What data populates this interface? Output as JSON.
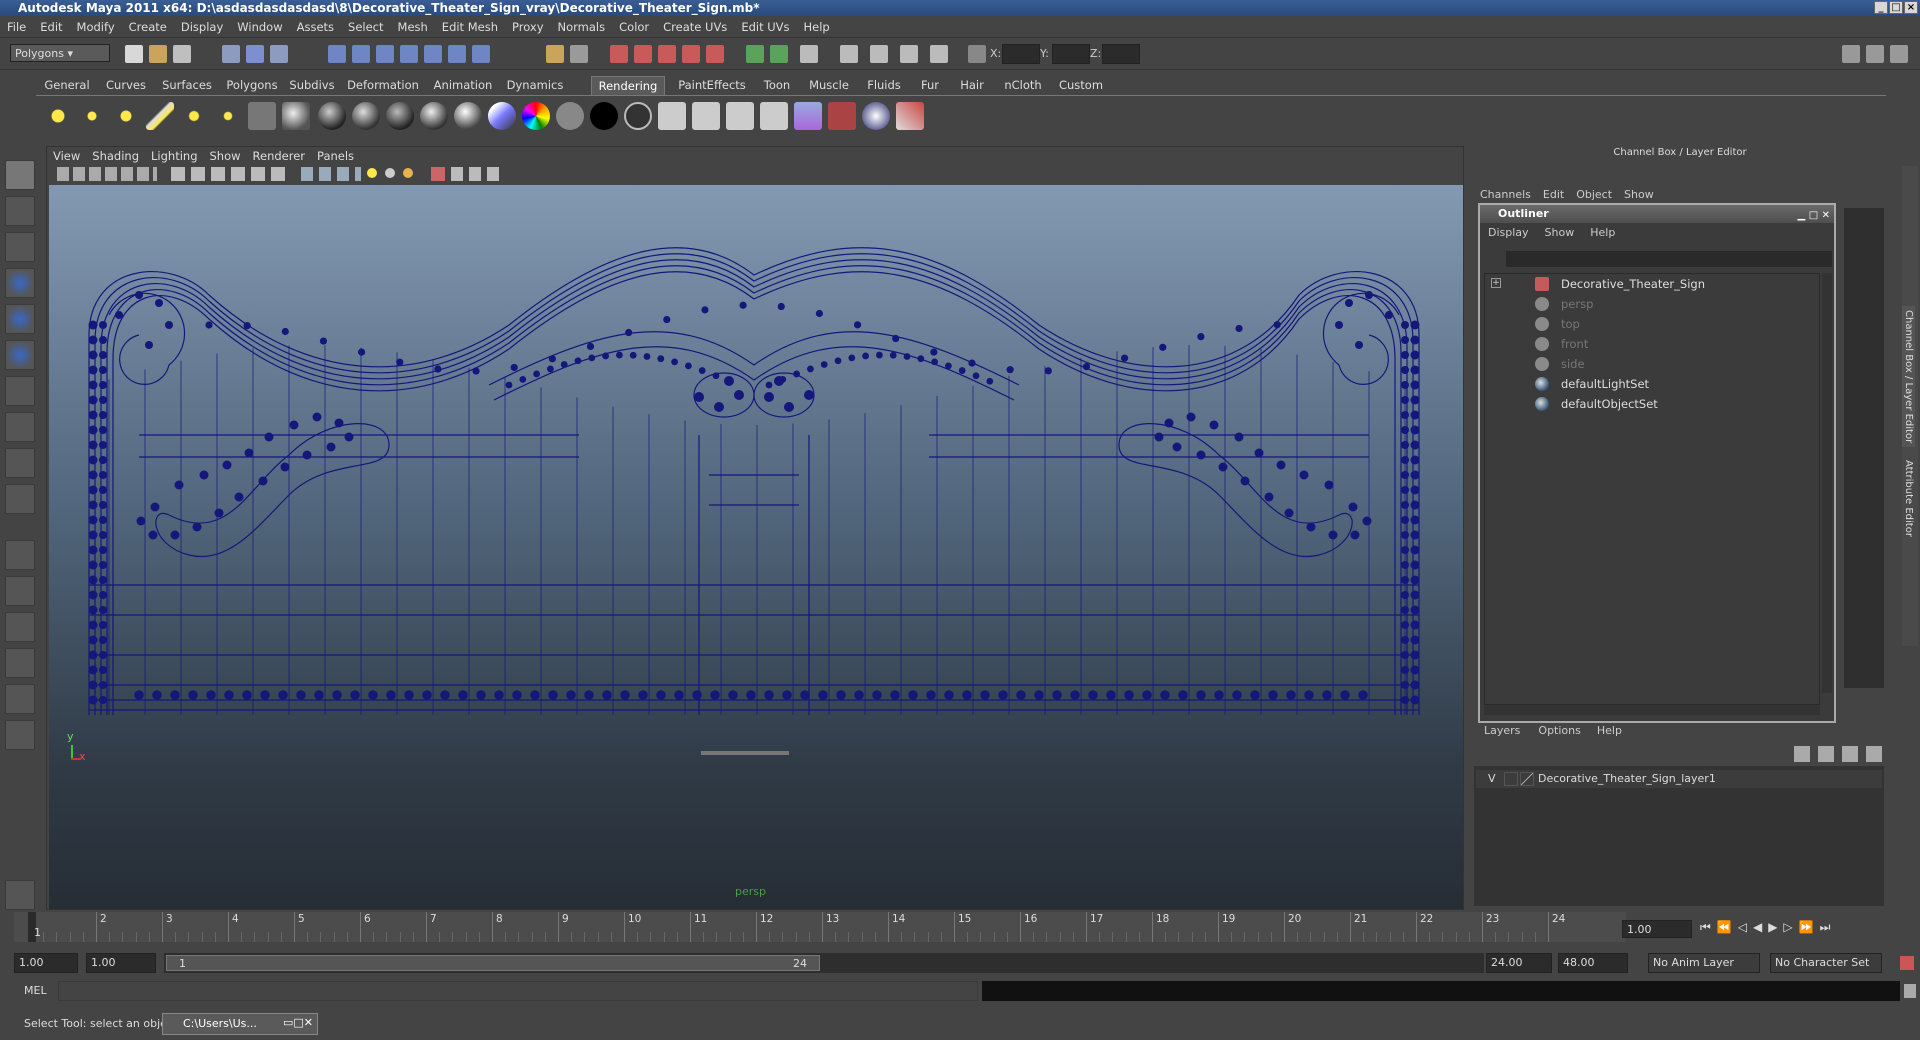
{
  "window": {
    "title": "Autodesk Maya 2011 x64: D:\\asdasdasdasdasd\\8\\Decorative_Theater_Sign_vray\\Decorative_Theater_Sign.mb*"
  },
  "menu": [
    "File",
    "Edit",
    "Modify",
    "Create",
    "Display",
    "Window",
    "Assets",
    "Select",
    "Mesh",
    "Edit Mesh",
    "Proxy",
    "Normals",
    "Color",
    "Create UVs",
    "Edit UVs",
    "Help"
  ],
  "toolbar": {
    "mode": "Polygons",
    "x_label": "X:",
    "y_label": "Y:",
    "z_label": "Z:"
  },
  "shelf_tabs": [
    "General",
    "Curves",
    "Surfaces",
    "Polygons",
    "Subdivs",
    "Deformation",
    "Animation",
    "Dynamics",
    "Rendering",
    "PaintEffects",
    "Toon",
    "Muscle",
    "Fluids",
    "Fur",
    "Hair",
    "nCloth",
    "Custom"
  ],
  "active_shelf_tab": "Rendering",
  "viewport": {
    "menu": [
      "View",
      "Shading",
      "Lighting",
      "Show",
      "Renderer",
      "Panels"
    ],
    "camera_label": "persp",
    "axis_y": "y",
    "axis_x": "x",
    "wire_color": "#15177a"
  },
  "channel_box": {
    "title": "Channel Box / Layer Editor",
    "menu": [
      "Channels",
      "Edit",
      "Object",
      "Show"
    ]
  },
  "side_tabs": [
    "Channel Box / Layer Editor",
    "Attribute Editor"
  ],
  "outliner": {
    "title": "Outliner",
    "menu": [
      "Display",
      "Show",
      "Help"
    ],
    "items": [
      {
        "label": "Decorative_Theater_Sign",
        "icon": "mesh-icon",
        "dim": false
      },
      {
        "label": "persp",
        "icon": "camera-icon",
        "dim": true
      },
      {
        "label": "top",
        "icon": "camera-icon",
        "dim": true
      },
      {
        "label": "front",
        "icon": "camera-icon",
        "dim": true
      },
      {
        "label": "side",
        "icon": "camera-icon",
        "dim": true
      },
      {
        "label": "defaultLightSet",
        "icon": "set-icon",
        "dim": false
      },
      {
        "label": "defaultObjectSet",
        "icon": "set-icon",
        "dim": false
      }
    ]
  },
  "layers": {
    "menu": [
      "Layers",
      "Options",
      "Help"
    ],
    "visibility": "V",
    "layer_name": "Decorative_Theater_Sign_layer1"
  },
  "timeline": {
    "ticks": [
      "1",
      "2",
      "3",
      "4",
      "5",
      "6",
      "7",
      "8",
      "9",
      "10",
      "11",
      "12",
      "13",
      "14",
      "15",
      "16",
      "17",
      "18",
      "19",
      "20",
      "21",
      "22",
      "23",
      "24"
    ],
    "current_frame": "1",
    "current_frame_field": "1.00"
  },
  "range": {
    "start": "1.00",
    "playback_start": "1.00",
    "slider_start": "1",
    "slider_end": "24",
    "playback_end": "24.00",
    "end": "48.00",
    "anim_layer": "No Anim Layer",
    "character_set": "No Character Set"
  },
  "mel": {
    "label": "MEL"
  },
  "status": {
    "help": "Select Tool: select an object",
    "task": "C:\\Users\\Us..."
  }
}
